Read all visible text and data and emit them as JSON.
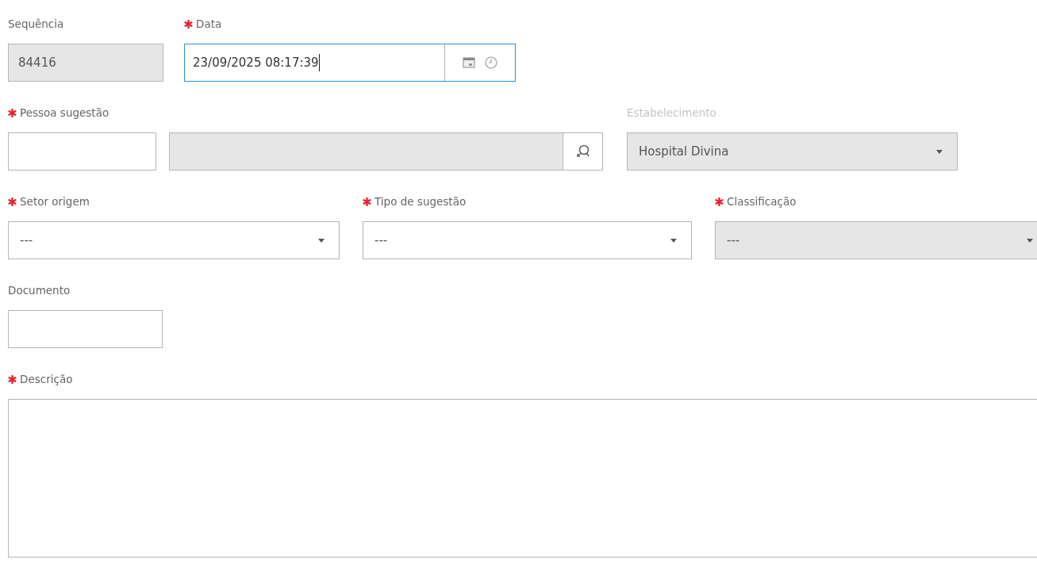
{
  "rows": [
    [
      {
        "kind": "text",
        "label": "Sequência",
        "required": false,
        "label_dimmed": false,
        "value": "84416",
        "disabled": true
      },
      {
        "kind": "datetime",
        "label": "Data",
        "required": true,
        "label_dimmed": false,
        "value": "23/09/2025 08:17:39",
        "focused": true
      }
    ],
    [
      {
        "kind": "lookup",
        "label": "Pessoa sugestão",
        "required": true,
        "label_dimmed": false,
        "code_disabled": false,
        "name_disabled": true
      },
      {
        "kind": "select",
        "label": "Estabelecimento",
        "required": false,
        "label_dimmed": true,
        "value": "Hospital Divina",
        "disabled": true
      }
    ],
    [
      {
        "kind": "select",
        "label": "Setor origem",
        "required": true,
        "label_dimmed": false,
        "value": "---",
        "disabled": false
      },
      {
        "kind": "select",
        "label": "Tipo de sugestão",
        "required": true,
        "label_dimmed": false,
        "value": "---",
        "disabled": false
      },
      {
        "kind": "select",
        "label": "Classificação",
        "required": true,
        "label_dimmed": false,
        "value": "---",
        "disabled": true
      }
    ],
    [
      {
        "kind": "text",
        "label": "Documento",
        "required": false,
        "label_dimmed": false,
        "disabled": false
      }
    ],
    [
      {
        "kind": "textarea",
        "label": "Descrição",
        "required": true,
        "label_dimmed": false
      }
    ]
  ]
}
